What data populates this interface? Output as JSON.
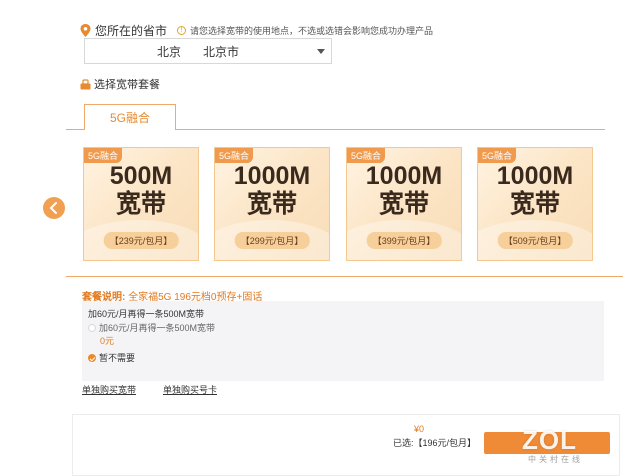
{
  "region": {
    "title": "您所在的省市",
    "notice": "请您选择宽带的使用地点，不选或选错会影响您成功办理产品",
    "province": "北京",
    "city": "北京市"
  },
  "packages": {
    "heading": "选择宽带套餐",
    "tab": "5G融合",
    "cards": [
      {
        "badge": "5G融合",
        "speed": "500M",
        "kind": "宽带",
        "price": "【239元/包月】"
      },
      {
        "badge": "5G融合",
        "speed": "1000M",
        "kind": "宽带",
        "price": "【299元/包月】"
      },
      {
        "badge": "5G融合",
        "speed": "1000M",
        "kind": "宽带",
        "price": "【399元/包月】"
      },
      {
        "badge": "5G融合",
        "speed": "1000M",
        "kind": "宽带",
        "price": "【509元/包月】"
      }
    ]
  },
  "description": {
    "label": "套餐说明:",
    "text": "全家福5G 196元档0预存+固话"
  },
  "addon": {
    "title": "加60元/月再得一条500M宽带",
    "option1": "加60元/月再得一条500M宽带",
    "option1_price": "0元",
    "option2": "暂不需要"
  },
  "links": {
    "buy_broadband": "单独购买宽带",
    "buy_card": "单独购买号卡"
  },
  "footer": {
    "total": "¥0",
    "selected": "已选:【196元/包月】"
  },
  "watermark": {
    "logo": "ZOL",
    "sub": "中关村在线"
  },
  "colors": {
    "accent": "#ef8a36",
    "card_border": "#f3c98f"
  }
}
